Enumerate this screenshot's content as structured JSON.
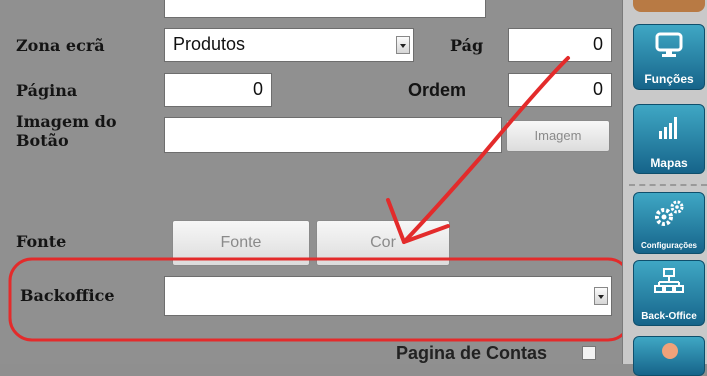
{
  "form": {
    "zona_ecra": {
      "label": "Zona ecrã",
      "value": "Produtos"
    },
    "pag": {
      "label": "Pág",
      "value": "0"
    },
    "pagina": {
      "label": "Página",
      "value": "0"
    },
    "ordem": {
      "label": "Ordem",
      "value": "0"
    },
    "imagem": {
      "label_line1": "Imagem do",
      "label_line2": "Botão",
      "value": "",
      "button_label": "Imagem"
    },
    "fonte": {
      "label": "Fonte",
      "fonte_button": "Fonte",
      "cor_button": "Cor"
    },
    "backoffice": {
      "label": "Backoffice",
      "value": ""
    },
    "pagina_contas": {
      "label": "Pagina de Contas"
    }
  },
  "sidebar": {
    "items": [
      {
        "label": "Funções",
        "icon": "monitor-icon"
      },
      {
        "label": "Mapas",
        "icon": "bar-chart-icon"
      },
      {
        "label": "Configurações",
        "icon": "gears-icon"
      },
      {
        "label": "Back-Office",
        "icon": "network-icon"
      }
    ]
  },
  "colors": {
    "annotation": "#e32b2b",
    "sidebar_button": "#1f7ea6"
  }
}
